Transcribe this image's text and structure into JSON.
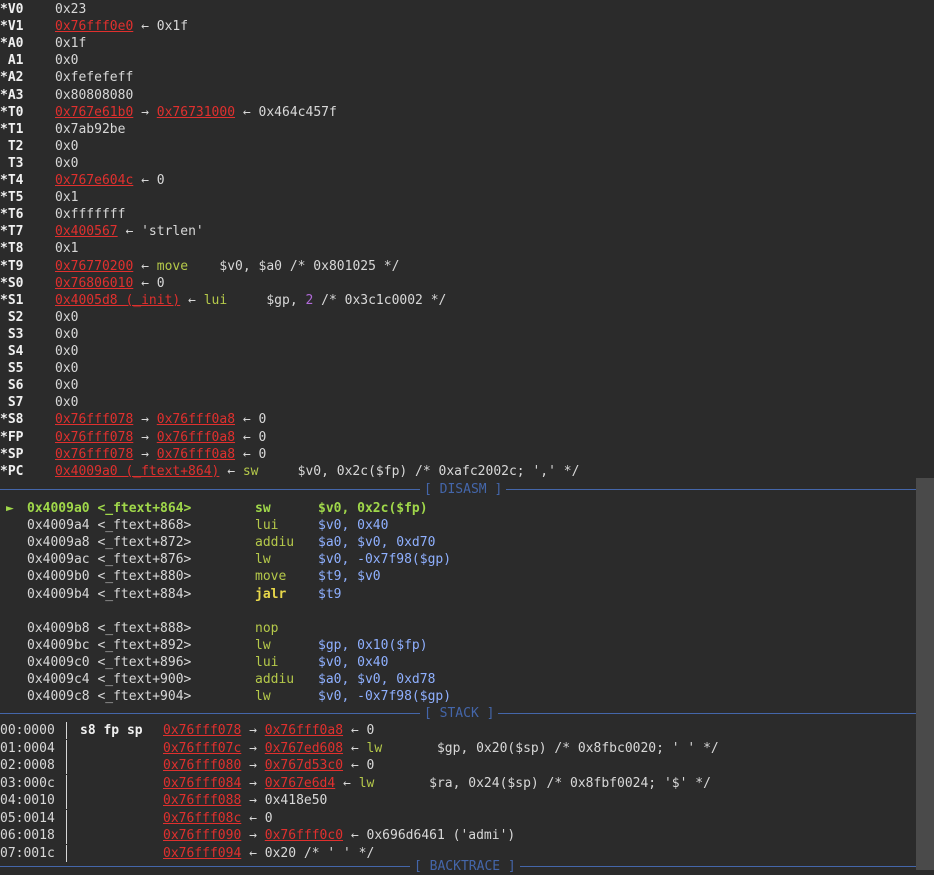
{
  "registers": [
    {
      "name": "*V0",
      "parts": [
        {
          "t": "0x23",
          "c": "w"
        }
      ]
    },
    {
      "name": "*V1",
      "parts": [
        {
          "t": "0x76fff0e0",
          "c": "addr"
        },
        {
          "t": " ← 0x1f",
          "c": "w"
        }
      ]
    },
    {
      "name": "*A0",
      "parts": [
        {
          "t": "0x1f",
          "c": "w"
        }
      ]
    },
    {
      "name": " A1",
      "parts": [
        {
          "t": "0x0",
          "c": "w"
        }
      ]
    },
    {
      "name": "*A2",
      "parts": [
        {
          "t": "0xfefefeff",
          "c": "w"
        }
      ]
    },
    {
      "name": "*A3",
      "parts": [
        {
          "t": "0x80808080",
          "c": "w"
        }
      ]
    },
    {
      "name": "*T0",
      "parts": [
        {
          "t": "0x767e61b0",
          "c": "addr"
        },
        {
          "t": " → ",
          "c": "w"
        },
        {
          "t": "0x76731000",
          "c": "addr"
        },
        {
          "t": " ← 0x464c457f",
          "c": "w"
        }
      ]
    },
    {
      "name": "*T1",
      "parts": [
        {
          "t": "0x7ab92be",
          "c": "w"
        }
      ]
    },
    {
      "name": " T2",
      "parts": [
        {
          "t": "0x0",
          "c": "w"
        }
      ]
    },
    {
      "name": " T3",
      "parts": [
        {
          "t": "0x0",
          "c": "w"
        }
      ]
    },
    {
      "name": "*T4",
      "parts": [
        {
          "t": "0x767e604c",
          "c": "addr"
        },
        {
          "t": " ← 0",
          "c": "w"
        }
      ]
    },
    {
      "name": "*T5",
      "parts": [
        {
          "t": "0x1",
          "c": "w"
        }
      ]
    },
    {
      "name": "*T6",
      "parts": [
        {
          "t": "0xfffffff",
          "c": "w"
        }
      ]
    },
    {
      "name": "*T7",
      "parts": [
        {
          "t": "0x400567",
          "c": "addr"
        },
        {
          "t": " ← 'strlen'",
          "c": "w"
        }
      ]
    },
    {
      "name": "*T8",
      "parts": [
        {
          "t": "0x1",
          "c": "w"
        }
      ]
    },
    {
      "name": "*T9",
      "parts": [
        {
          "t": "0x76770200",
          "c": "addr"
        },
        {
          "t": " ← ",
          "c": "w"
        },
        {
          "t": "move",
          "c": "g"
        },
        {
          "t": "    $v0, $a0 /* 0x801025 */",
          "c": "w"
        }
      ]
    },
    {
      "name": "*S0",
      "parts": [
        {
          "t": "0x76806010",
          "c": "addr"
        },
        {
          "t": " ← 0",
          "c": "w"
        }
      ]
    },
    {
      "name": "*S1",
      "parts": [
        {
          "t": "0x4005d8 (_init)",
          "c": "addr"
        },
        {
          "t": " ← ",
          "c": "w"
        },
        {
          "t": "lui",
          "c": "g"
        },
        {
          "t": "     $gp, ",
          "c": "w"
        },
        {
          "t": "2",
          "c": "p"
        },
        {
          "t": " /* 0x3c1c0002 */",
          "c": "w"
        }
      ]
    },
    {
      "name": " S2",
      "parts": [
        {
          "t": "0x0",
          "c": "w"
        }
      ]
    },
    {
      "name": " S3",
      "parts": [
        {
          "t": "0x0",
          "c": "w"
        }
      ]
    },
    {
      "name": " S4",
      "parts": [
        {
          "t": "0x0",
          "c": "w"
        }
      ]
    },
    {
      "name": " S5",
      "parts": [
        {
          "t": "0x0",
          "c": "w"
        }
      ]
    },
    {
      "name": " S6",
      "parts": [
        {
          "t": "0x0",
          "c": "w"
        }
      ]
    },
    {
      "name": " S7",
      "parts": [
        {
          "t": "0x0",
          "c": "w"
        }
      ]
    },
    {
      "name": "*S8",
      "parts": [
        {
          "t": "0x76fff078",
          "c": "addr"
        },
        {
          "t": " → ",
          "c": "w"
        },
        {
          "t": "0x76fff0a8",
          "c": "addr"
        },
        {
          "t": " ← 0",
          "c": "w"
        }
      ]
    },
    {
      "name": "*FP",
      "parts": [
        {
          "t": "0x76fff078",
          "c": "addr"
        },
        {
          "t": " → ",
          "c": "w"
        },
        {
          "t": "0x76fff0a8",
          "c": "addr"
        },
        {
          "t": " ← 0",
          "c": "w"
        }
      ]
    },
    {
      "name": "*SP",
      "parts": [
        {
          "t": "0x76fff078",
          "c": "addr"
        },
        {
          "t": " → ",
          "c": "w"
        },
        {
          "t": "0x76fff0a8",
          "c": "addr"
        },
        {
          "t": " ← 0",
          "c": "w"
        }
      ]
    },
    {
      "name": "*PC",
      "parts": [
        {
          "t": "0x4009a0 (_ftext+864)",
          "c": "addr"
        },
        {
          "t": " ← ",
          "c": "w"
        },
        {
          "t": "sw",
          "c": "g"
        },
        {
          "t": "     $v0, 0x2c($fp) /* 0xafc2002c; ',' */",
          "c": "w"
        }
      ]
    }
  ],
  "disasm": {
    "title": "[ DISASM ]",
    "lines": [
      {
        "addr": "0x4009a0 <_ftext+864>",
        "op": "sw",
        "operands": "$v0, 0x2c($fp)",
        "current": true
      },
      {
        "addr": "0x4009a4 <_ftext+868>",
        "op": "lui",
        "operands": "$v0, 0x40"
      },
      {
        "addr": "0x4009a8 <_ftext+872>",
        "op": "addiu",
        "operands": "$a0, $v0, 0xd70"
      },
      {
        "addr": "0x4009ac <_ftext+876>",
        "op": "lw",
        "operands": "$v0, -0x7f98($gp)"
      },
      {
        "addr": "0x4009b0 <_ftext+880>",
        "op": "move",
        "operands": "$t9, $v0"
      },
      {
        "addr": "0x4009b4 <_ftext+884>",
        "op": "jalr",
        "operands": "$t9"
      },
      {
        "addr": "",
        "op": "",
        "operands": ""
      },
      {
        "addr": "0x4009b8 <_ftext+888>",
        "op": "nop",
        "operands": ""
      },
      {
        "addr": "0x4009bc <_ftext+892>",
        "op": "lw",
        "operands": "$gp, 0x10($fp)"
      },
      {
        "addr": "0x4009c0 <_ftext+896>",
        "op": "lui",
        "operands": "$v0, 0x40"
      },
      {
        "addr": "0x4009c4 <_ftext+900>",
        "op": "addiu",
        "operands": "$a0, $v0, 0xd78"
      },
      {
        "addr": "0x4009c8 <_ftext+904>",
        "op": "lw",
        "operands": "$v0, -0x7f98($gp)"
      }
    ]
  },
  "stack": {
    "title": "[ STACK ]",
    "rows": [
      {
        "off": "00:0000",
        "regs": "s8 fp sp",
        "parts": [
          {
            "t": "0x76fff078",
            "c": "addr"
          },
          {
            "t": " → ",
            "c": "w"
          },
          {
            "t": "0x76fff0a8",
            "c": "addr"
          },
          {
            "t": " ← 0",
            "c": "w"
          }
        ]
      },
      {
        "off": "01:0004",
        "regs": "",
        "parts": [
          {
            "t": "0x76fff07c",
            "c": "addr"
          },
          {
            "t": " → ",
            "c": "w"
          },
          {
            "t": "0x767ed608",
            "c": "addr"
          },
          {
            "t": " ← ",
            "c": "w"
          },
          {
            "t": "lw",
            "c": "g"
          },
          {
            "t": "       $gp, 0x20($sp) /* 0x8fbc0020; ' ' */",
            "c": "w"
          }
        ]
      },
      {
        "off": "02:0008",
        "regs": "",
        "parts": [
          {
            "t": "0x76fff080",
            "c": "addr"
          },
          {
            "t": " → ",
            "c": "w"
          },
          {
            "t": "0x767d53c0",
            "c": "addr"
          },
          {
            "t": " ← 0",
            "c": "w"
          }
        ]
      },
      {
        "off": "03:000c",
        "regs": "",
        "parts": [
          {
            "t": "0x76fff084",
            "c": "addr"
          },
          {
            "t": " → ",
            "c": "w"
          },
          {
            "t": "0x767e6d4",
            "c": "addr"
          },
          {
            "t": " ← ",
            "c": "w"
          },
          {
            "t": "lw",
            "c": "g"
          },
          {
            "t": "       $ra, 0x24($sp) /* 0x8fbf0024; '$' */",
            "c": "w"
          }
        ]
      },
      {
        "off": "04:0010",
        "regs": "",
        "parts": [
          {
            "t": "0x76fff088",
            "c": "addr"
          },
          {
            "t": " → 0x418e50",
            "c": "w"
          }
        ]
      },
      {
        "off": "05:0014",
        "regs": "",
        "parts": [
          {
            "t": "0x76fff08c",
            "c": "addr"
          },
          {
            "t": " ← 0",
            "c": "w"
          }
        ]
      },
      {
        "off": "06:0018",
        "regs": "",
        "parts": [
          {
            "t": "0x76fff090",
            "c": "addr"
          },
          {
            "t": " → ",
            "c": "w"
          },
          {
            "t": "0x76fff0c0",
            "c": "addr"
          },
          {
            "t": " ← 0x696d6461 ('admi')",
            "c": "w"
          }
        ]
      },
      {
        "off": "07:001c",
        "regs": "",
        "parts": [
          {
            "t": "0x76fff094",
            "c": "addr"
          },
          {
            "t": " ← 0x20 /* ' ' */",
            "c": "w"
          }
        ]
      }
    ]
  },
  "backtrace": {
    "title": "[ BACKTRACE ]"
  },
  "colors": {
    "bg": "#2b2b2b",
    "address": "#e0302e",
    "instruction": "#b5c94a",
    "immediate": "#b06ad8",
    "separator": "#4466aa",
    "current": "#a0d84a"
  }
}
